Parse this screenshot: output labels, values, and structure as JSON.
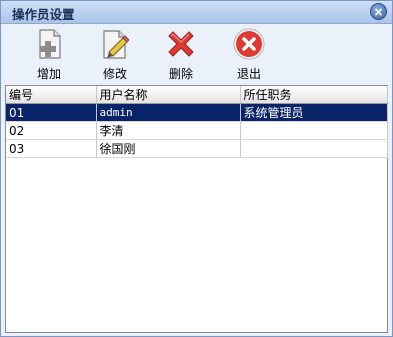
{
  "window": {
    "title": "操作员设置"
  },
  "icons": {
    "close": "close-icon"
  },
  "toolbar": {
    "add_label": "增加",
    "edit_label": "修改",
    "delete_label": "删除",
    "exit_label": "退出"
  },
  "table": {
    "headers": [
      "编号",
      "用户名称",
      "所任职务"
    ],
    "rows": [
      {
        "id": "01",
        "name": "admin",
        "role": "系统管理员",
        "selected": true
      },
      {
        "id": "02",
        "name": "李清",
        "role": ""
      },
      {
        "id": "03",
        "name": "徐国刚",
        "role": ""
      }
    ]
  },
  "colors": {
    "selection": "#0a246a",
    "titlebar": "#aac4ea",
    "delete_red": "#d9322c"
  }
}
